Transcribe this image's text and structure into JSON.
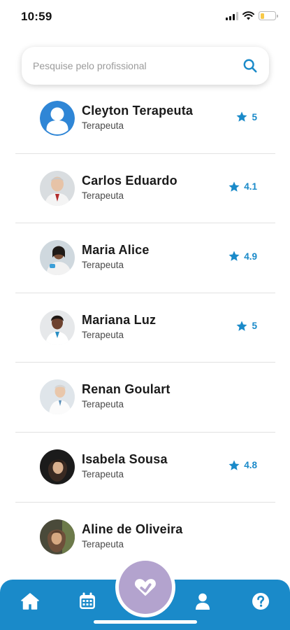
{
  "status_bar": {
    "time": "10:59"
  },
  "search": {
    "placeholder": "Pesquise pelo profissional",
    "value": ""
  },
  "professionals": [
    {
      "name": "Cleyton Terapeuta",
      "role": "Terapeuta",
      "rating": "5",
      "avatar": "default-user-avatar"
    },
    {
      "name": "Carlos Eduardo",
      "role": "Terapeuta",
      "rating": "4.1",
      "avatar": "photo-avatar"
    },
    {
      "name": "Maria Alice",
      "role": "Terapeuta",
      "rating": "4.9",
      "avatar": "photo-avatar"
    },
    {
      "name": "Mariana Luz",
      "role": "Terapeuta",
      "rating": "5",
      "avatar": "photo-avatar"
    },
    {
      "name": "Renan Goulart",
      "role": "Terapeuta",
      "rating": "",
      "avatar": "photo-avatar"
    },
    {
      "name": "Isabela Sousa",
      "role": "Terapeuta",
      "rating": "4.8",
      "avatar": "photo-avatar"
    },
    {
      "name": "Aline de Oliveira",
      "role": "Terapeuta",
      "rating": "",
      "avatar": "photo-avatar"
    }
  ],
  "bottom_nav": {
    "items": [
      "home-icon",
      "calendar-icon",
      "heart-logo-icon",
      "user-icon",
      "help-icon"
    ]
  },
  "colors": {
    "accent": "#1a8ac9",
    "center_button": "#b3a3ce",
    "battery": "#f7c948"
  }
}
